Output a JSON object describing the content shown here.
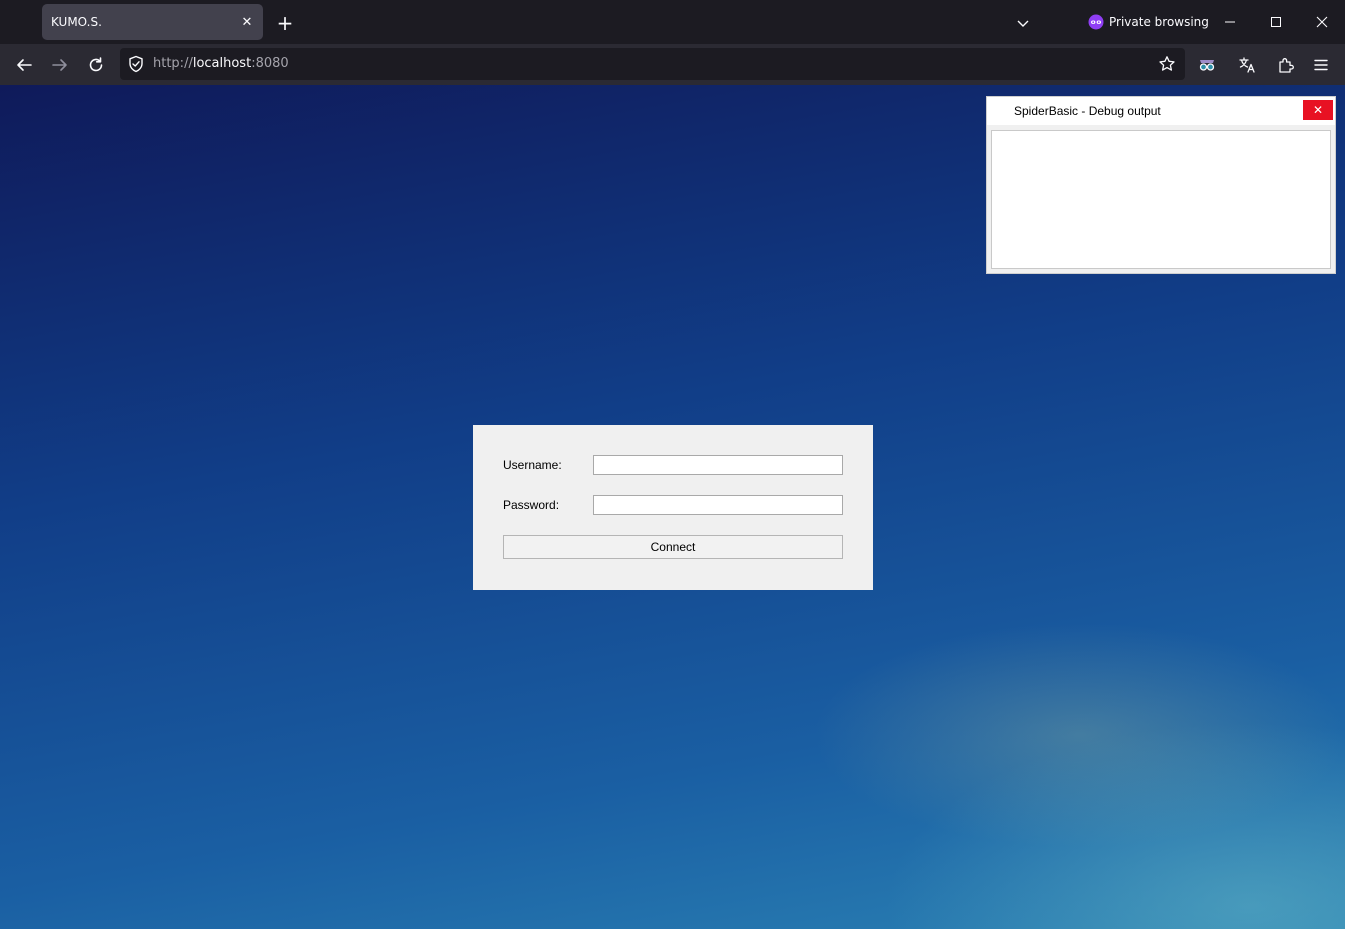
{
  "browser": {
    "tab": {
      "title": "KUMO.S.",
      "close_glyph": "✕"
    },
    "new_tab_glyph": "+",
    "private_label": "Private browsing",
    "window_controls": {
      "minimize": "—",
      "maximize": "☐",
      "close": "✕"
    },
    "url": {
      "scheme": "http://",
      "host": "localhost",
      "port": ":8080"
    }
  },
  "icons": {
    "back": "back-arrow-icon",
    "forward": "forward-arrow-icon",
    "reload": "reload-icon",
    "shield": "tracking-protection-shield-icon",
    "bookmark": "bookmark-star-icon",
    "extension": "extension-puzzle-icon",
    "menu": "hamburger-menu-icon",
    "private": "private-browsing-mask-icon"
  },
  "login": {
    "username_label": "Username:",
    "password_label": "Password:",
    "username_value": "",
    "password_value": "",
    "connect_label": "Connect"
  },
  "debug": {
    "title": "SpiderBasic - Debug output",
    "close_glyph": "✕",
    "output": ""
  },
  "colors": {
    "tab_strip": "#1c1b22",
    "nav_bar": "#2b2a33",
    "active_tab": "#42414d",
    "close_red": "#e81123",
    "private_purple": "#8f3ef4"
  }
}
